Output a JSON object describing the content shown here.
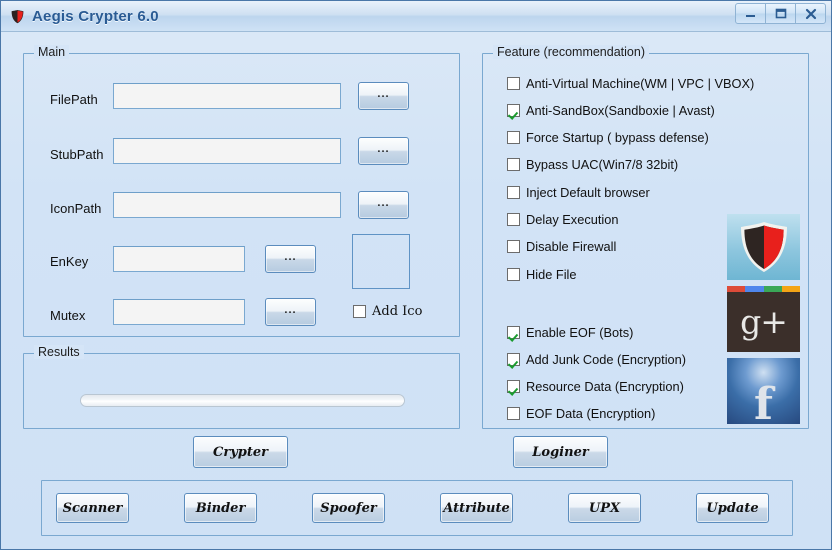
{
  "window": {
    "title": "Aegis Crypter 6.0",
    "icon": "shield-icon",
    "controls": {
      "minimize": "minimize-icon",
      "maximize": "maximize-icon",
      "close": "close-icon"
    }
  },
  "main_group": {
    "legend": "Main",
    "fields": [
      {
        "label": "FilePath",
        "value": "",
        "placeholder": "",
        "browse_label": "..."
      },
      {
        "label": "StubPath",
        "value": "",
        "placeholder": "",
        "browse_label": "..."
      },
      {
        "label": "IconPath",
        "value": "",
        "placeholder": "",
        "browse_label": "..."
      },
      {
        "label": "EnKey",
        "value": "",
        "placeholder": "",
        "browse_label": "..."
      },
      {
        "label": "Mutex",
        "value": "",
        "placeholder": "",
        "browse_label": "..."
      }
    ],
    "add_ico": {
      "label": "Add Ico",
      "checked": false
    }
  },
  "results_group": {
    "legend": "Results",
    "progress_percent": 0
  },
  "feature_group": {
    "legend": "Feature (recommendation)",
    "options": [
      {
        "label": "Anti-Virtual Machine(WM | VPC | VBOX)",
        "checked": false
      },
      {
        "label": "Anti-SandBox(Sandboxie | Avast)",
        "checked": true
      },
      {
        "label": "Force Startup ( bypass defense)",
        "checked": false
      },
      {
        "label": "Bypass UAC(Win7/8 32bit)",
        "checked": false
      },
      {
        "label": "Inject Default browser",
        "checked": false
      },
      {
        "label": "Delay Execution",
        "checked": false
      },
      {
        "label": "Disable Firewall",
        "checked": false
      },
      {
        "label": "Hide File",
        "checked": false
      }
    ],
    "encryption_options": [
      {
        "label": "Enable EOF (Bots)",
        "checked": true
      },
      {
        "label": "Add Junk Code (Encryption)",
        "checked": true
      },
      {
        "label": "Resource Data (Encryption)",
        "checked": true
      },
      {
        "label": "EOF Data (Encryption)",
        "checked": false
      }
    ],
    "logos": [
      {
        "name": "aegis-shield-logo",
        "text": ""
      },
      {
        "name": "google-plus-logo",
        "text": "g+"
      },
      {
        "name": "facebook-logo",
        "text": "f"
      }
    ]
  },
  "actions": {
    "crypter": "Crypter",
    "loginer": "Loginer"
  },
  "tools": [
    {
      "label": "Scanner"
    },
    {
      "label": "Binder"
    },
    {
      "label": "Spoofer"
    },
    {
      "label": "Attribute"
    },
    {
      "label": "UPX"
    },
    {
      "label": "Update"
    }
  ],
  "colors": {
    "window_bg": "#d2e3f6",
    "title_text": "#2a5b94",
    "group_border": "#7aa8d0",
    "check_green": "#1a9b2e",
    "shield_red": "#e8201c"
  }
}
